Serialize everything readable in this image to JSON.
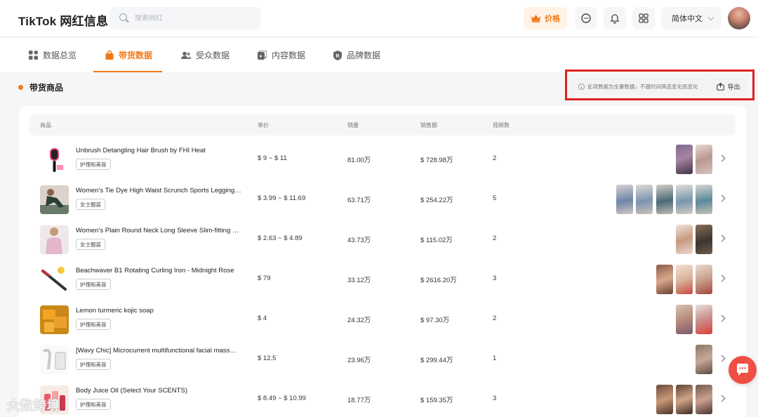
{
  "header": {
    "logo": "TikTok 网红信息",
    "search_placeholder": "搜索网红",
    "price_label": "价格",
    "language": "简体中文"
  },
  "tabs": [
    {
      "label": "数据总览",
      "icon": "grid-icon",
      "active": false
    },
    {
      "label": "带货数据",
      "icon": "shopping-bag-icon",
      "active": true
    },
    {
      "label": "受众数据",
      "icon": "users-icon",
      "active": false
    },
    {
      "label": "内容数据",
      "icon": "content-icon",
      "active": false
    },
    {
      "label": "品牌数据",
      "icon": "brand-icon",
      "active": false
    }
  ],
  "section": {
    "title": "带货商品",
    "notice": "此项数据为全量数据，不跟时间筛选变化而变化",
    "export_label": "导出"
  },
  "table": {
    "columns": [
      "商品",
      "单价",
      "销量",
      "销售额",
      "视频数"
    ],
    "rows": [
      {
        "name": "Unbrush Detangling Hair Brush by FHI Heat",
        "tag": "护理和美容",
        "price": "$ 9 ~ $ 11",
        "sales": "81.00万",
        "revenue": "$ 728.98万",
        "videos": "2"
      },
      {
        "name": "Women's Tie Dye High Waist Scrunch Sports Leggings…",
        "tag": "女士服装",
        "price": "$ 3.99 ~ $ 11.69",
        "sales": "63.71万",
        "revenue": "$ 254.22万",
        "videos": "5"
      },
      {
        "name": "Women's Plain Round Neck Long Sleeve Slim-fitting …",
        "tag": "女士服装",
        "price": "$ 2.63 ~ $ 4.89",
        "sales": "43.73万",
        "revenue": "$ 115.02万",
        "videos": "2"
      },
      {
        "name": "Beachwaver B1 Rotating Curling Iron - Midnight Rose",
        "tag": "护理和美容",
        "price": "$ 79",
        "sales": "33.12万",
        "revenue": "$ 2616.20万",
        "videos": "3"
      },
      {
        "name": "Lemon turmeric kojic soap",
        "tag": "护理和美容",
        "price": "$ 4",
        "sales": "24.32万",
        "revenue": "$ 97.30万",
        "videos": "2"
      },
      {
        "name": "[Wavy Chic] Microcurrent multifunctional facial mass…",
        "tag": "护理和美容",
        "price": "$ 12.5",
        "sales": "23.96万",
        "revenue": "$ 299.44万",
        "videos": "1"
      },
      {
        "name": "Body Juice Oil (Select Your SCENTS)",
        "tag": "护理和美容",
        "price": "$ 8.49 ~ $ 10.99",
        "sales": "18.77万",
        "revenue": "$ 159.35万",
        "videos": "3"
      }
    ]
  },
  "watermark": "大数跨境"
}
